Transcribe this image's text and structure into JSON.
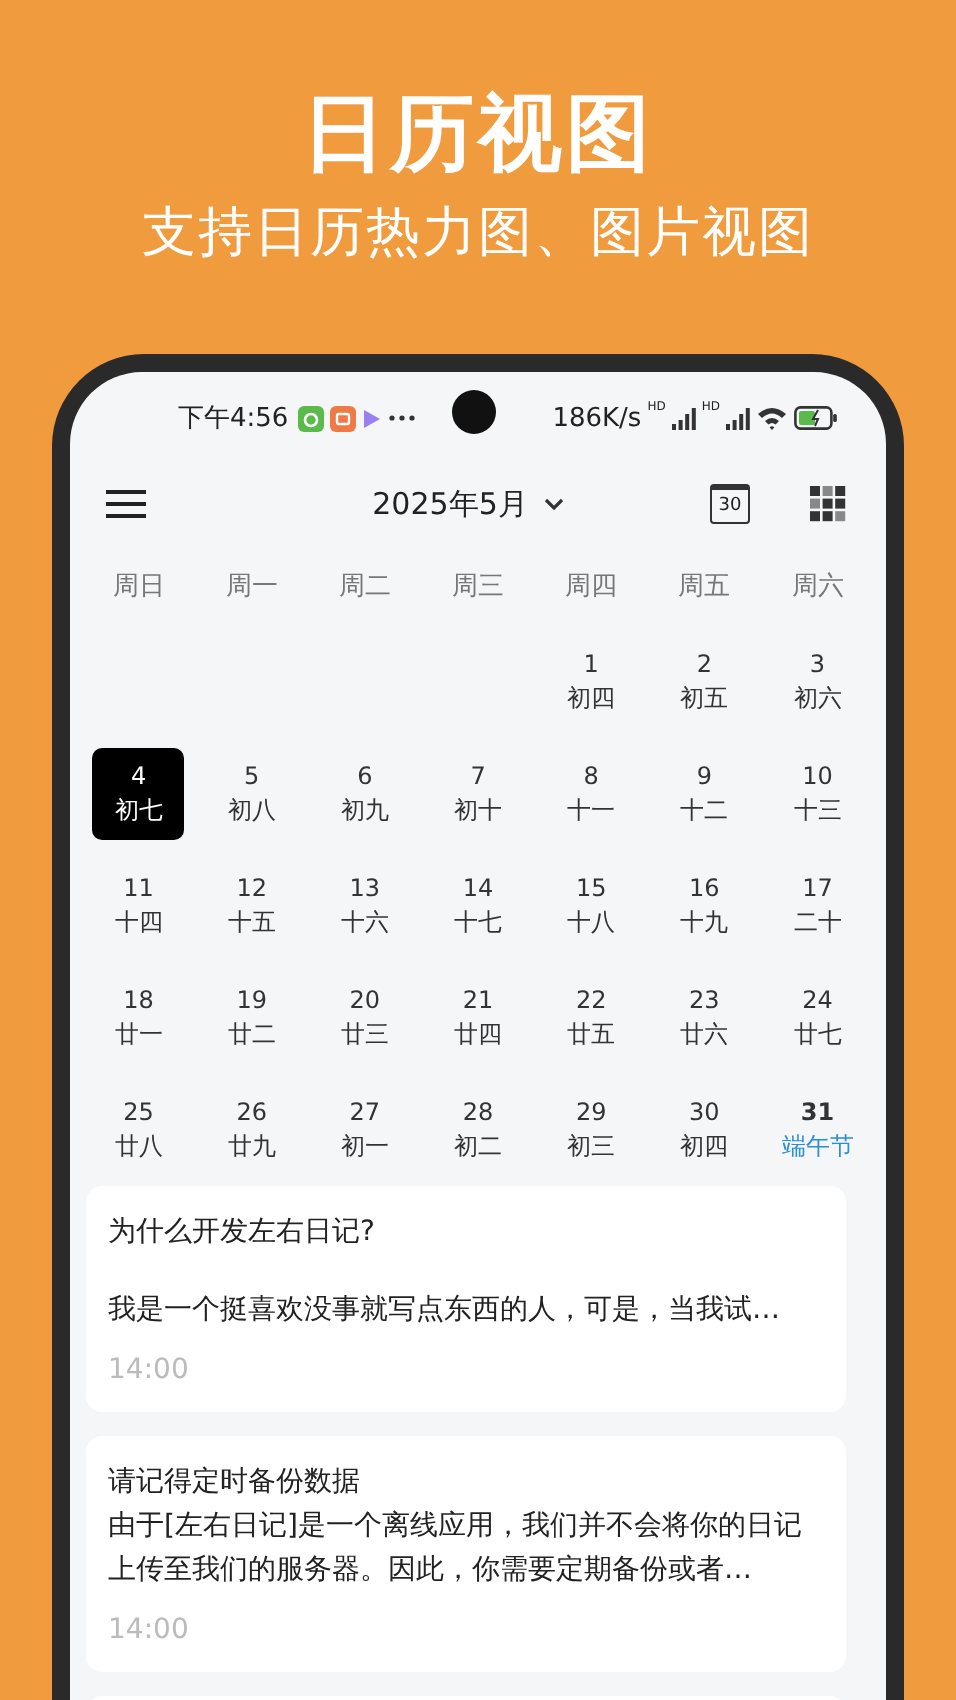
{
  "promo": {
    "title": "日历视图",
    "subtitle": "支持日历热力图、图片视图"
  },
  "status_bar": {
    "time": "下午4:56",
    "speed": "186K/s",
    "network_labels": [
      "HD",
      "HD"
    ]
  },
  "header": {
    "month": "2025年5月",
    "calendar_badge": "30"
  },
  "weekdays": [
    "周日",
    "周一",
    "周二",
    "周三",
    "周四",
    "周五",
    "周六"
  ],
  "weeks": [
    [
      {
        "day": "1",
        "lunar": "初四",
        "selected": false,
        "holiday": false
      },
      {
        "day": "2",
        "lunar": "初五",
        "selected": false,
        "holiday": false
      },
      {
        "day": "3",
        "lunar": "初六",
        "selected": false,
        "holiday": false
      }
    ],
    [
      {
        "day": "4",
        "lunar": "初七",
        "selected": true,
        "holiday": false
      },
      {
        "day": "5",
        "lunar": "初八",
        "selected": false,
        "holiday": false
      },
      {
        "day": "6",
        "lunar": "初九",
        "selected": false,
        "holiday": false
      },
      {
        "day": "7",
        "lunar": "初十",
        "selected": false,
        "holiday": false
      },
      {
        "day": "8",
        "lunar": "十一",
        "selected": false,
        "holiday": false
      },
      {
        "day": "9",
        "lunar": "十二",
        "selected": false,
        "holiday": false
      },
      {
        "day": "10",
        "lunar": "十三",
        "selected": false,
        "holiday": false
      }
    ],
    [
      {
        "day": "11",
        "lunar": "十四",
        "selected": false,
        "holiday": false
      },
      {
        "day": "12",
        "lunar": "十五",
        "selected": false,
        "holiday": false
      },
      {
        "day": "13",
        "lunar": "十六",
        "selected": false,
        "holiday": false
      },
      {
        "day": "14",
        "lunar": "十七",
        "selected": false,
        "holiday": false
      },
      {
        "day": "15",
        "lunar": "十八",
        "selected": false,
        "holiday": false
      },
      {
        "day": "16",
        "lunar": "十九",
        "selected": false,
        "holiday": false
      },
      {
        "day": "17",
        "lunar": "二十",
        "selected": false,
        "holiday": false
      }
    ],
    [
      {
        "day": "18",
        "lunar": "廿一",
        "selected": false,
        "holiday": false
      },
      {
        "day": "19",
        "lunar": "廿二",
        "selected": false,
        "holiday": false
      },
      {
        "day": "20",
        "lunar": "廿三",
        "selected": false,
        "holiday": false
      },
      {
        "day": "21",
        "lunar": "廿四",
        "selected": false,
        "holiday": false
      },
      {
        "day": "22",
        "lunar": "廿五",
        "selected": false,
        "holiday": false
      },
      {
        "day": "23",
        "lunar": "廿六",
        "selected": false,
        "holiday": false
      },
      {
        "day": "24",
        "lunar": "廿七",
        "selected": false,
        "holiday": false
      }
    ],
    [
      {
        "day": "25",
        "lunar": "廿八",
        "selected": false,
        "holiday": false
      },
      {
        "day": "26",
        "lunar": "廿九",
        "selected": false,
        "holiday": false
      },
      {
        "day": "27",
        "lunar": "初一",
        "selected": false,
        "holiday": false
      },
      {
        "day": "28",
        "lunar": "初二",
        "selected": false,
        "holiday": false
      },
      {
        "day": "29",
        "lunar": "初三",
        "selected": false,
        "holiday": false
      },
      {
        "day": "30",
        "lunar": "初四",
        "selected": false,
        "holiday": false
      },
      {
        "day": "31",
        "lunar": "端午节",
        "selected": false,
        "holiday": true
      }
    ]
  ],
  "entries": [
    {
      "title": "为什么开发左右日记?",
      "body": "我是一个挺喜欢没事就写点东西的人，可是，当我试…",
      "blank_line": true,
      "time": "14:00"
    },
    {
      "title": "请记得定时备份数据",
      "body": "由于[左右日记]是一个离线应用，我们并不会将你的日记上传至我们的服务器。因此，你需要定期备份或者…",
      "blank_line": false,
      "time": "14:00"
    }
  ]
}
